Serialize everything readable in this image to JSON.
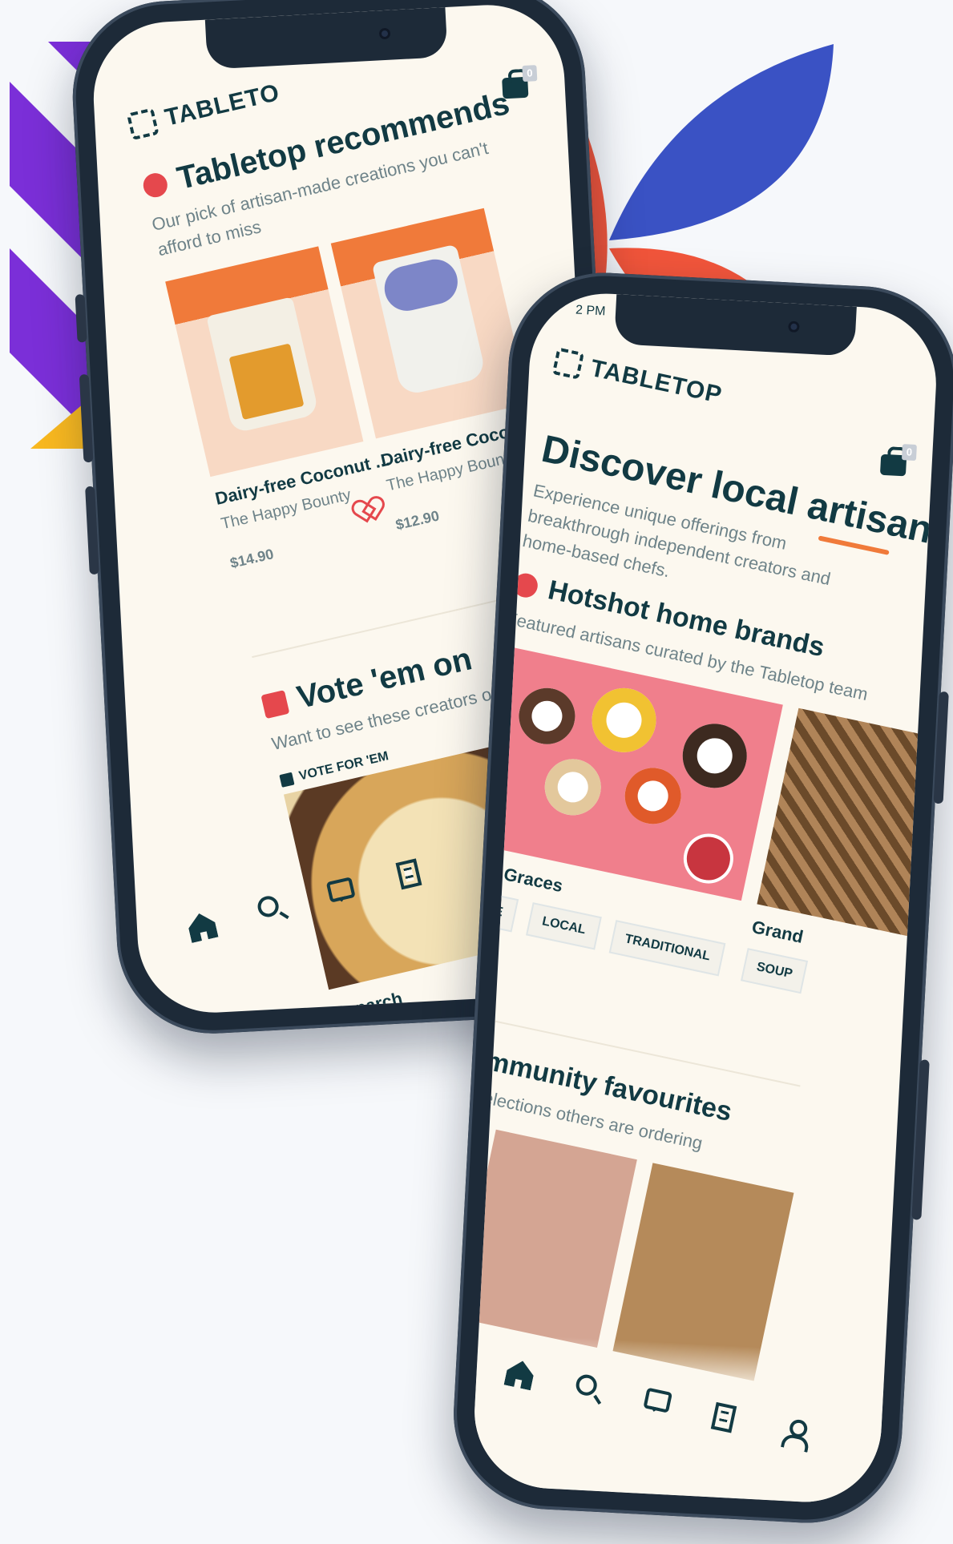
{
  "brand": {
    "name": "TABLETOP"
  },
  "colors": {
    "accent": "#e5484d",
    "ink": "#123a43",
    "muted": "#6e8389",
    "orange": "#f07a3a",
    "purple": "#7b2fd8",
    "blue": "#3a52c4",
    "red": "#f1553b",
    "yellow": "#f8b820"
  },
  "phone_left": {
    "brand_partial": "TABLETO",
    "cart_count": "0",
    "recommends": {
      "title": "Tabletop recommends",
      "subtitle": "Our pick of artisan-made creations you can't afford to miss",
      "icon": "dish-icon",
      "products": [
        {
          "title": "Dairy-free Coconut ...",
          "vendor": "The Happy Bounty",
          "price": "$14.90"
        },
        {
          "title": "Dairy-free Coconut ...",
          "vendor": "The Happy Bounty",
          "price": "$12.90"
        }
      ]
    },
    "vote": {
      "title": "Vote 'em on",
      "subtitle": "Want to see these creators on Tabletop? Don't",
      "badge": "VOTE FOR 'EM",
      "creator": "Paparch"
    },
    "nav": [
      "home-icon",
      "search-icon",
      "chat-icon",
      "receipt-icon"
    ]
  },
  "phone_right": {
    "status_time": "2 PM",
    "brand": "TABLETOP",
    "cart_count": "0",
    "hero_title": "Discover local artisans.",
    "hero_subtitle": "Experience unique offerings from breakthrough independent creators and home-based chefs.",
    "hotshot": {
      "title": "Hotshot home brands",
      "subtitle": "Featured artisans curated by the Tabletop team",
      "brands": [
        {
          "name": "Good Graces",
          "tags": [
            "SAUCE",
            "LOCAL",
            "TRADITIONAL"
          ]
        },
        {
          "name": "Grand",
          "tags": [
            "SOUP"
          ]
        }
      ]
    },
    "community": {
      "title": "Community favourites",
      "subtitle": "Must-try selections others are ordering"
    },
    "nav": [
      "home-icon",
      "search-icon",
      "chat-icon",
      "receipt-icon",
      "user-icon"
    ]
  }
}
